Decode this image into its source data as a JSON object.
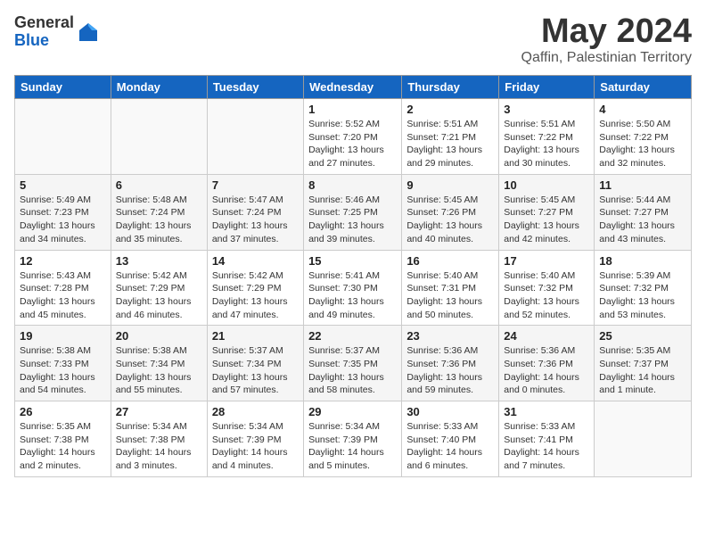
{
  "header": {
    "logo_general": "General",
    "logo_blue": "Blue",
    "month_year": "May 2024",
    "location": "Qaffin, Palestinian Territory"
  },
  "weekdays": [
    "Sunday",
    "Monday",
    "Tuesday",
    "Wednesday",
    "Thursday",
    "Friday",
    "Saturday"
  ],
  "weeks": [
    [
      {
        "day": "",
        "info": ""
      },
      {
        "day": "",
        "info": ""
      },
      {
        "day": "",
        "info": ""
      },
      {
        "day": "1",
        "info": "Sunrise: 5:52 AM\nSunset: 7:20 PM\nDaylight: 13 hours\nand 27 minutes."
      },
      {
        "day": "2",
        "info": "Sunrise: 5:51 AM\nSunset: 7:21 PM\nDaylight: 13 hours\nand 29 minutes."
      },
      {
        "day": "3",
        "info": "Sunrise: 5:51 AM\nSunset: 7:22 PM\nDaylight: 13 hours\nand 30 minutes."
      },
      {
        "day": "4",
        "info": "Sunrise: 5:50 AM\nSunset: 7:22 PM\nDaylight: 13 hours\nand 32 minutes."
      }
    ],
    [
      {
        "day": "5",
        "info": "Sunrise: 5:49 AM\nSunset: 7:23 PM\nDaylight: 13 hours\nand 34 minutes."
      },
      {
        "day": "6",
        "info": "Sunrise: 5:48 AM\nSunset: 7:24 PM\nDaylight: 13 hours\nand 35 minutes."
      },
      {
        "day": "7",
        "info": "Sunrise: 5:47 AM\nSunset: 7:24 PM\nDaylight: 13 hours\nand 37 minutes."
      },
      {
        "day": "8",
        "info": "Sunrise: 5:46 AM\nSunset: 7:25 PM\nDaylight: 13 hours\nand 39 minutes."
      },
      {
        "day": "9",
        "info": "Sunrise: 5:45 AM\nSunset: 7:26 PM\nDaylight: 13 hours\nand 40 minutes."
      },
      {
        "day": "10",
        "info": "Sunrise: 5:45 AM\nSunset: 7:27 PM\nDaylight: 13 hours\nand 42 minutes."
      },
      {
        "day": "11",
        "info": "Sunrise: 5:44 AM\nSunset: 7:27 PM\nDaylight: 13 hours\nand 43 minutes."
      }
    ],
    [
      {
        "day": "12",
        "info": "Sunrise: 5:43 AM\nSunset: 7:28 PM\nDaylight: 13 hours\nand 45 minutes."
      },
      {
        "day": "13",
        "info": "Sunrise: 5:42 AM\nSunset: 7:29 PM\nDaylight: 13 hours\nand 46 minutes."
      },
      {
        "day": "14",
        "info": "Sunrise: 5:42 AM\nSunset: 7:29 PM\nDaylight: 13 hours\nand 47 minutes."
      },
      {
        "day": "15",
        "info": "Sunrise: 5:41 AM\nSunset: 7:30 PM\nDaylight: 13 hours\nand 49 minutes."
      },
      {
        "day": "16",
        "info": "Sunrise: 5:40 AM\nSunset: 7:31 PM\nDaylight: 13 hours\nand 50 minutes."
      },
      {
        "day": "17",
        "info": "Sunrise: 5:40 AM\nSunset: 7:32 PM\nDaylight: 13 hours\nand 52 minutes."
      },
      {
        "day": "18",
        "info": "Sunrise: 5:39 AM\nSunset: 7:32 PM\nDaylight: 13 hours\nand 53 minutes."
      }
    ],
    [
      {
        "day": "19",
        "info": "Sunrise: 5:38 AM\nSunset: 7:33 PM\nDaylight: 13 hours\nand 54 minutes."
      },
      {
        "day": "20",
        "info": "Sunrise: 5:38 AM\nSunset: 7:34 PM\nDaylight: 13 hours\nand 55 minutes."
      },
      {
        "day": "21",
        "info": "Sunrise: 5:37 AM\nSunset: 7:34 PM\nDaylight: 13 hours\nand 57 minutes."
      },
      {
        "day": "22",
        "info": "Sunrise: 5:37 AM\nSunset: 7:35 PM\nDaylight: 13 hours\nand 58 minutes."
      },
      {
        "day": "23",
        "info": "Sunrise: 5:36 AM\nSunset: 7:36 PM\nDaylight: 13 hours\nand 59 minutes."
      },
      {
        "day": "24",
        "info": "Sunrise: 5:36 AM\nSunset: 7:36 PM\nDaylight: 14 hours\nand 0 minutes."
      },
      {
        "day": "25",
        "info": "Sunrise: 5:35 AM\nSunset: 7:37 PM\nDaylight: 14 hours\nand 1 minute."
      }
    ],
    [
      {
        "day": "26",
        "info": "Sunrise: 5:35 AM\nSunset: 7:38 PM\nDaylight: 14 hours\nand 2 minutes."
      },
      {
        "day": "27",
        "info": "Sunrise: 5:34 AM\nSunset: 7:38 PM\nDaylight: 14 hours\nand 3 minutes."
      },
      {
        "day": "28",
        "info": "Sunrise: 5:34 AM\nSunset: 7:39 PM\nDaylight: 14 hours\nand 4 minutes."
      },
      {
        "day": "29",
        "info": "Sunrise: 5:34 AM\nSunset: 7:39 PM\nDaylight: 14 hours\nand 5 minutes."
      },
      {
        "day": "30",
        "info": "Sunrise: 5:33 AM\nSunset: 7:40 PM\nDaylight: 14 hours\nand 6 minutes."
      },
      {
        "day": "31",
        "info": "Sunrise: 5:33 AM\nSunset: 7:41 PM\nDaylight: 14 hours\nand 7 minutes."
      },
      {
        "day": "",
        "info": ""
      }
    ]
  ]
}
